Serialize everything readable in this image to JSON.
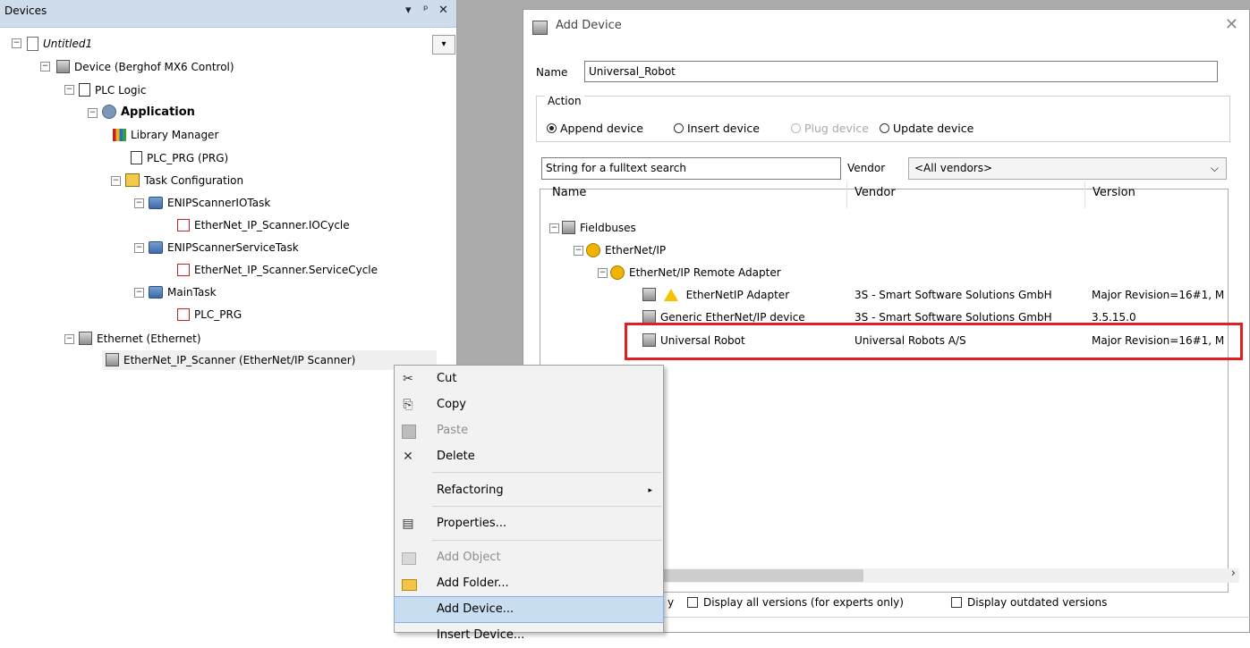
{
  "devices_panel": {
    "title": "Devices",
    "header_buttons": {
      "dropdown": "▾",
      "pin": "ᵖ",
      "close": "✕"
    },
    "dropdown_arrow": "▾",
    "tree": [
      {
        "label": "Untitled1",
        "italic": true
      },
      {
        "label": "Device (Berghof MX6 Control)"
      },
      {
        "label": "PLC Logic"
      },
      {
        "label": "Application",
        "bold": true
      },
      {
        "label": "Library Manager"
      },
      {
        "label": "PLC_PRG (PRG)"
      },
      {
        "label": "Task Configuration"
      },
      {
        "label": "ENIPScannerIOTask"
      },
      {
        "label": "EtherNet_IP_Scanner.IOCycle"
      },
      {
        "label": "ENIPScannerServiceTask"
      },
      {
        "label": "EtherNet_IP_Scanner.ServiceCycle"
      },
      {
        "label": "MainTask"
      },
      {
        "label": "PLC_PRG"
      },
      {
        "label": "Ethernet (Ethernet)"
      },
      {
        "label": "EtherNet_IP_Scanner (EtherNet/IP Scanner)"
      }
    ]
  },
  "context_menu": {
    "items": [
      {
        "label": "Cut",
        "icon": "✂"
      },
      {
        "label": "Copy",
        "icon": "⎘"
      },
      {
        "label": "Paste",
        "icon": "📋",
        "disabled": true
      },
      {
        "label": "Delete",
        "icon": "✕"
      },
      {
        "label": "Refactoring",
        "submenu_arrow": "▸"
      },
      {
        "label": "Properties...",
        "icon": "▤"
      },
      {
        "label": "Add Object",
        "disabled": true
      },
      {
        "label": "Add Folder..."
      },
      {
        "label": "Add Device..."
      },
      {
        "label": "Insert Device..."
      }
    ]
  },
  "dialog": {
    "title": "Add Device",
    "close": "✕",
    "name_label": "Name",
    "name_value": "Universal_Robot",
    "action_label": "Action",
    "actions": [
      {
        "label": "Append device",
        "selected": true
      },
      {
        "label": "Insert device"
      },
      {
        "label": "Plug device",
        "disabled": true
      },
      {
        "label": "Update device"
      }
    ],
    "search_placeholder": "String for a fulltext search",
    "vendor_label": "Vendor",
    "vendor_value": "<All vendors>",
    "vendor_chevron": "⌵",
    "columns": [
      "Name",
      "Vendor",
      "Version"
    ],
    "rows": [
      {
        "name": "Fieldbuses",
        "vendor": "",
        "version": ""
      },
      {
        "name": "EtherNet/IP",
        "vendor": "",
        "version": ""
      },
      {
        "name": "EtherNet/IP Remote Adapter",
        "vendor": "",
        "version": ""
      },
      {
        "name": "EtherNetIP Adapter",
        "vendor": "3S - Smart Software Solutions GmbH",
        "version": "Major Revision=16#1, M",
        "warning": "!"
      },
      {
        "name": "Generic EtherNet/IP device",
        "vendor": "3S - Smart Software Solutions GmbH",
        "version": "3.5.15.0"
      },
      {
        "name": "Universal Robot",
        "vendor": "Universal Robots A/S",
        "version": "Major Revision=16#1, M",
        "highlighted": true
      }
    ],
    "scroll_arrow": "›",
    "partial_label": "y",
    "options": [
      {
        "label": "Display all versions (for experts only)",
        "checked": false
      },
      {
        "label": "Display outdated versions",
        "checked": false
      }
    ],
    "colors": {
      "highlight": "#e02020",
      "menu_highlight": "#c9ddf1",
      "panel_header": "#cfdcec"
    }
  }
}
